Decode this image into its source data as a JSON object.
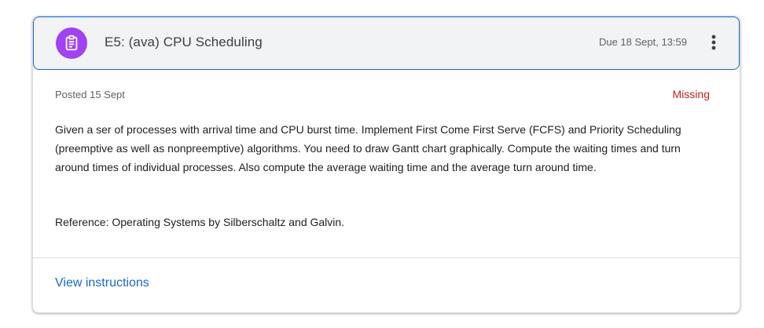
{
  "assignment": {
    "icon": "assignment-icon",
    "title": "E5: (ava) CPU Scheduling",
    "due": "Due 18 Sept, 13:59",
    "more_icon": "more-vert-icon"
  },
  "details": {
    "posted": "Posted 15 Sept",
    "status": "Missing",
    "description": "Given a ser of processes with arrival time and CPU burst time. Implement First Come First Serve (FCFS) and Priority Scheduling (preemptive as well as nonpreemptive) algorithms. You need to draw Gantt chart graphically. Compute the waiting times and turn around times of individual processes. Also compute the average waiting time and the average turn around time.",
    "reference": "Reference: Operating Systems by Silberschaltz and Galvin."
  },
  "footer": {
    "view_instructions": "View instructions"
  },
  "colors": {
    "accent": "#1967d2",
    "icon_bg": "#a142f4",
    "missing": "#c5221f"
  }
}
